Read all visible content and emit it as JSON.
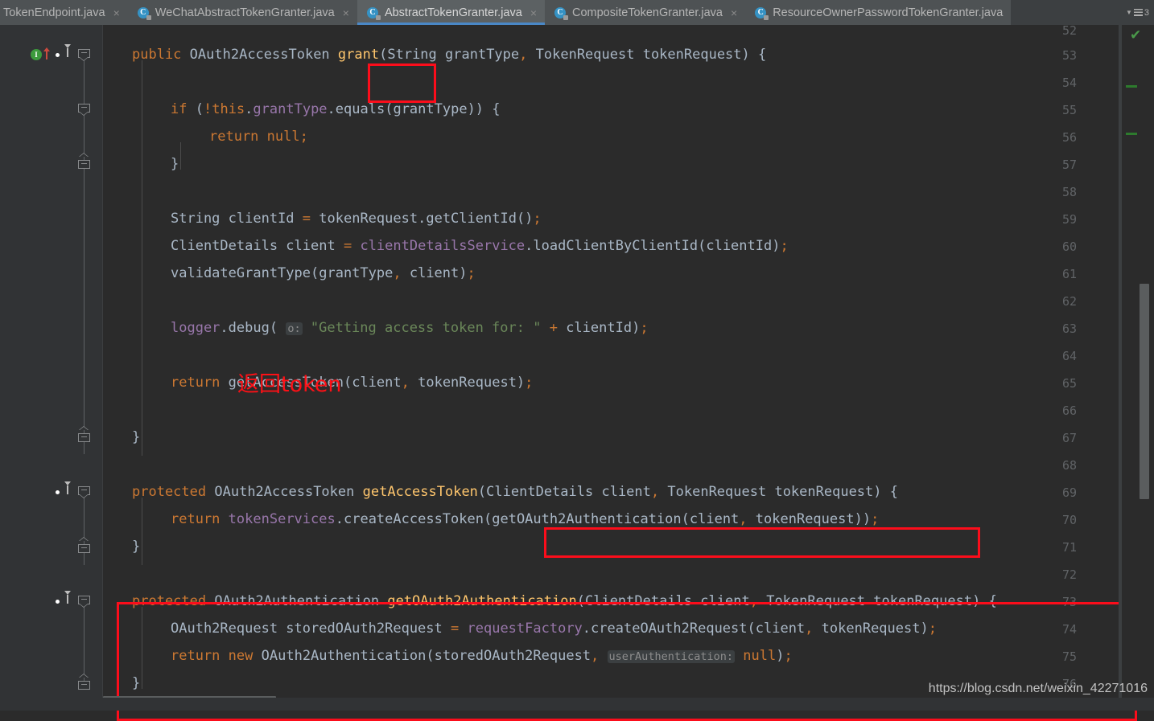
{
  "window": {
    "app": "IntelliJ IDEA",
    "active_file": "AbstractTokenGranter.java"
  },
  "tabbar": {
    "tabs": [
      {
        "label": "TokenEndpoint.java",
        "icon": "java-class-icon",
        "active": false,
        "has_icon": false,
        "closable": true
      },
      {
        "label": "WeChatAbstractTokenGranter.java",
        "icon": "java-class-icon",
        "active": false,
        "has_icon": true,
        "closable": true
      },
      {
        "label": "AbstractTokenGranter.java",
        "icon": "java-abstract-class-icon",
        "active": true,
        "has_icon": true,
        "closable": true
      },
      {
        "label": "CompositeTokenGranter.java",
        "icon": "java-class-icon",
        "active": false,
        "has_icon": true,
        "closable": true
      },
      {
        "label": "ResourceOwnerPasswordTokenGranter.java",
        "icon": "java-class-icon",
        "active": false,
        "has_icon": true,
        "closable": false
      }
    ],
    "close_glyph": "×",
    "overflow_chevron": "▼",
    "overflow_icon": "tab-list-icon",
    "hidden_tab_count": "3"
  },
  "gutter": {
    "line_numbers": [
      "52",
      "53",
      "54",
      "55",
      "56",
      "57",
      "58",
      "59",
      "60",
      "61",
      "62",
      "63",
      "64",
      "65",
      "66",
      "67",
      "68",
      "69",
      "70",
      "71",
      "72",
      "73",
      "74",
      "75",
      "76"
    ],
    "markers": [
      {
        "line": "53",
        "icons": [
          "implementing-method-icon",
          "implemented-up-arrow-icon",
          "overriding-method-icon",
          "overridden-down-arrow-icon"
        ],
        "impl_glyph": "I"
      },
      {
        "line": "69",
        "icons": [
          "overriding-method-icon",
          "overridden-down-arrow-icon"
        ]
      },
      {
        "line": "73",
        "icons": [
          "overriding-method-icon",
          "overridden-down-arrow-icon"
        ]
      }
    ]
  },
  "code": {
    "lines": [
      {
        "n": "52",
        "text": ""
      },
      {
        "n": "53",
        "tokens": [
          {
            "t": "public",
            "c": "kw"
          },
          {
            "t": " ",
            "c": "punc"
          },
          {
            "t": "OAuth2AccessToken",
            "c": "type"
          },
          {
            "t": " ",
            "c": "punc"
          },
          {
            "t": "grant",
            "c": "method"
          },
          {
            "t": "(",
            "c": "punc"
          },
          {
            "t": "String",
            "c": "type"
          },
          {
            "t": " grantType",
            "c": "ident"
          },
          {
            "t": ",",
            "c": "semi"
          },
          {
            "t": " ",
            "c": "punc"
          },
          {
            "t": "TokenRequest",
            "c": "type"
          },
          {
            "t": " tokenRequest",
            "c": "ident"
          },
          {
            "t": ")",
            "c": "punc"
          },
          {
            "t": " ",
            "c": "punc"
          },
          {
            "t": "{",
            "c": "punc"
          }
        ]
      },
      {
        "n": "54",
        "text": ""
      },
      {
        "n": "55",
        "indent": 1,
        "tokens": [
          {
            "t": "if",
            "c": "kw"
          },
          {
            "t": " (",
            "c": "punc"
          },
          {
            "t": "!",
            "c": "semi"
          },
          {
            "t": "this",
            "c": "kw"
          },
          {
            "t": ".",
            "c": "punc"
          },
          {
            "t": "grantType",
            "c": "field"
          },
          {
            "t": ".",
            "c": "punc"
          },
          {
            "t": "equals",
            "c": "ident"
          },
          {
            "t": "(grantType))",
            "c": "punc"
          },
          {
            "t": " ",
            "c": "punc"
          },
          {
            "t": "{",
            "c": "punc"
          }
        ]
      },
      {
        "n": "56",
        "indent": 2,
        "tokens": [
          {
            "t": "return",
            "c": "kw"
          },
          {
            "t": " ",
            "c": "punc"
          },
          {
            "t": "null",
            "c": "kw"
          },
          {
            "t": ";",
            "c": "semi"
          }
        ]
      },
      {
        "n": "57",
        "indent": 1,
        "tokens": [
          {
            "t": "}",
            "c": "punc"
          }
        ]
      },
      {
        "n": "58",
        "text": ""
      },
      {
        "n": "59",
        "indent": 1,
        "tokens": [
          {
            "t": "String",
            "c": "type"
          },
          {
            "t": " clientId ",
            "c": "ident"
          },
          {
            "t": "=",
            "c": "semi"
          },
          {
            "t": " tokenRequest",
            "c": "ident"
          },
          {
            "t": ".",
            "c": "punc"
          },
          {
            "t": "getClientId",
            "c": "ident"
          },
          {
            "t": "()",
            "c": "punc"
          },
          {
            "t": ";",
            "c": "semi"
          }
        ]
      },
      {
        "n": "60",
        "indent": 1,
        "tokens": [
          {
            "t": "ClientDetails",
            "c": "type"
          },
          {
            "t": " client ",
            "c": "ident"
          },
          {
            "t": "=",
            "c": "semi"
          },
          {
            "t": " ",
            "c": "punc"
          },
          {
            "t": "clientDetailsService",
            "c": "field"
          },
          {
            "t": ".",
            "c": "punc"
          },
          {
            "t": "loadClientByClientId",
            "c": "ident"
          },
          {
            "t": "(clientId)",
            "c": "punc"
          },
          {
            "t": ";",
            "c": "semi"
          }
        ]
      },
      {
        "n": "61",
        "indent": 1,
        "tokens": [
          {
            "t": "validateGrantType",
            "c": "ident"
          },
          {
            "t": "(grantType",
            "c": "punc"
          },
          {
            "t": ",",
            "c": "semi"
          },
          {
            "t": " client)",
            "c": "punc"
          },
          {
            "t": ";",
            "c": "semi"
          }
        ]
      },
      {
        "n": "62",
        "text": ""
      },
      {
        "n": "63",
        "indent": 1,
        "tokens": [
          {
            "t": "logger",
            "c": "field"
          },
          {
            "t": ".",
            "c": "punc"
          },
          {
            "t": "debug",
            "c": "ident"
          },
          {
            "t": "(",
            "c": "punc"
          },
          {
            "t": " ",
            "c": "punc"
          },
          {
            "t": "o:",
            "c": "hint"
          },
          {
            "t": " ",
            "c": "punc"
          },
          {
            "t": "\"Getting access token for: \"",
            "c": "str"
          },
          {
            "t": " ",
            "c": "punc"
          },
          {
            "t": "+",
            "c": "semi"
          },
          {
            "t": " clientId)",
            "c": "punc"
          },
          {
            "t": ";",
            "c": "semi"
          }
        ]
      },
      {
        "n": "64",
        "text": ""
      },
      {
        "n": "65",
        "indent": 1,
        "tokens": [
          {
            "t": "return",
            "c": "kw"
          },
          {
            "t": " ",
            "c": "punc"
          },
          {
            "t": "getAccessToken",
            "c": "ident"
          },
          {
            "t": "(client",
            "c": "punc"
          },
          {
            "t": ",",
            "c": "semi"
          },
          {
            "t": " tokenRequest)",
            "c": "punc"
          },
          {
            "t": ";",
            "c": "semi"
          }
        ]
      },
      {
        "n": "66",
        "text": ""
      },
      {
        "n": "67",
        "tokens": [
          {
            "t": "}",
            "c": "punc"
          }
        ]
      },
      {
        "n": "68",
        "text": ""
      },
      {
        "n": "69",
        "tokens": [
          {
            "t": "protected",
            "c": "kw"
          },
          {
            "t": " ",
            "c": "punc"
          },
          {
            "t": "OAuth2AccessToken",
            "c": "type"
          },
          {
            "t": " ",
            "c": "punc"
          },
          {
            "t": "getAccessToken",
            "c": "method"
          },
          {
            "t": "(",
            "c": "punc"
          },
          {
            "t": "ClientDetails",
            "c": "type"
          },
          {
            "t": " client",
            "c": "ident"
          },
          {
            "t": ",",
            "c": "semi"
          },
          {
            "t": " ",
            "c": "punc"
          },
          {
            "t": "TokenRequest",
            "c": "type"
          },
          {
            "t": " tokenRequest",
            "c": "ident"
          },
          {
            "t": ")",
            "c": "punc"
          },
          {
            "t": " ",
            "c": "punc"
          },
          {
            "t": "{",
            "c": "punc"
          }
        ]
      },
      {
        "n": "70",
        "indent": 1,
        "tokens": [
          {
            "t": "return",
            "c": "kw"
          },
          {
            "t": " ",
            "c": "punc"
          },
          {
            "t": "tokenServices",
            "c": "field"
          },
          {
            "t": ".",
            "c": "punc"
          },
          {
            "t": "createAccessToken",
            "c": "ident"
          },
          {
            "t": "(",
            "c": "punc"
          },
          {
            "t": "getOAuth2Authentication",
            "c": "ident"
          },
          {
            "t": "(client",
            "c": "punc"
          },
          {
            "t": ",",
            "c": "semi"
          },
          {
            "t": " tokenRequest))",
            "c": "punc"
          },
          {
            "t": ";",
            "c": "semi"
          }
        ]
      },
      {
        "n": "71",
        "tokens": [
          {
            "t": "}",
            "c": "punc"
          }
        ]
      },
      {
        "n": "72",
        "text": ""
      },
      {
        "n": "73",
        "tokens": [
          {
            "t": "protected",
            "c": "kw"
          },
          {
            "t": " ",
            "c": "punc"
          },
          {
            "t": "OAuth2Authentication",
            "c": "type"
          },
          {
            "t": " ",
            "c": "punc"
          },
          {
            "t": "getOAuth2Authentication",
            "c": "method"
          },
          {
            "t": "(",
            "c": "punc"
          },
          {
            "t": "ClientDetails",
            "c": "type"
          },
          {
            "t": " client",
            "c": "ident"
          },
          {
            "t": ",",
            "c": "semi"
          },
          {
            "t": " ",
            "c": "punc"
          },
          {
            "t": "TokenRequest",
            "c": "type"
          },
          {
            "t": " tokenRequest",
            "c": "ident"
          },
          {
            "t": ")",
            "c": "punc"
          },
          {
            "t": " ",
            "c": "punc"
          },
          {
            "t": "{",
            "c": "punc"
          }
        ]
      },
      {
        "n": "74",
        "indent": 1,
        "tokens": [
          {
            "t": "OAuth2Request",
            "c": "type"
          },
          {
            "t": " storedOAuth2Request ",
            "c": "ident"
          },
          {
            "t": "=",
            "c": "semi"
          },
          {
            "t": " ",
            "c": "punc"
          },
          {
            "t": "requestFactory",
            "c": "field"
          },
          {
            "t": ".",
            "c": "punc"
          },
          {
            "t": "createOAuth2Request",
            "c": "ident"
          },
          {
            "t": "(client",
            "c": "punc"
          },
          {
            "t": ",",
            "c": "semi"
          },
          {
            "t": " tokenRequest)",
            "c": "punc"
          },
          {
            "t": ";",
            "c": "semi"
          }
        ]
      },
      {
        "n": "75",
        "indent": 1,
        "tokens": [
          {
            "t": "return",
            "c": "kw"
          },
          {
            "t": " ",
            "c": "punc"
          },
          {
            "t": "new",
            "c": "kw"
          },
          {
            "t": " ",
            "c": "punc"
          },
          {
            "t": "OAuth2Authentication",
            "c": "type"
          },
          {
            "t": "(storedOAuth2Request",
            "c": "punc"
          },
          {
            "t": ",",
            "c": "semi"
          },
          {
            "t": " ",
            "c": "punc"
          },
          {
            "t": "userAuthentication:",
            "c": "hint"
          },
          {
            "t": " ",
            "c": "punc"
          },
          {
            "t": "null",
            "c": "kw"
          },
          {
            "t": ")",
            "c": "punc"
          },
          {
            "t": ";",
            "c": "semi"
          }
        ]
      },
      {
        "n": "76",
        "tokens": [
          {
            "t": "}",
            "c": "punc"
          }
        ]
      }
    ]
  },
  "annotations": {
    "boxes": [
      {
        "name": "grant-method-highlight",
        "target": "grant("
      },
      {
        "name": "getoauth2authentication-call-highlight",
        "target": "getOAuth2Authentication(client, tokenRequest)"
      },
      {
        "name": "getoauth2authentication-method-body-highlight",
        "target": "getOAuth2Authentication method block lines 73-76"
      }
    ],
    "texts": [
      {
        "name": "return-token-annotation",
        "value": "返回token",
        "color": "#fd1016"
      }
    ]
  },
  "markers": {
    "inspection_status": "✔",
    "inspection_status_name": "no-problems-checkmark",
    "stripes": [
      "todo-stripe",
      "todo-stripe"
    ]
  },
  "watermark": {
    "text": "https://blog.csdn.net/weixin_42271016"
  },
  "colors": {
    "editor_bg": "#2b2b2b",
    "gutter_bg": "#313335",
    "tabbar_bg": "#3c3f41",
    "active_tab_bg": "#5c6163",
    "active_tab_underline": "#4a88c7",
    "keyword": "#cc7832",
    "identifier": "#a9b7c6",
    "method": "#ffc66d",
    "field": "#9876aa",
    "string": "#6a8759",
    "annotation_red": "#fd1016",
    "line_number": "#606366"
  }
}
